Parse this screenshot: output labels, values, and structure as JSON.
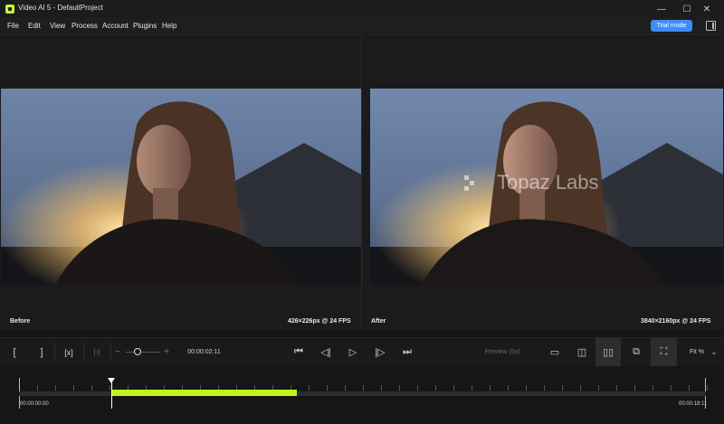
{
  "window": {
    "title": "Video AI 5 - DefaultProject"
  },
  "menu": [
    "File",
    "Edit",
    "View",
    "Process",
    "Account",
    "Plugins",
    "Help"
  ],
  "trial_label": "Trial mode",
  "before": {
    "label": "Before",
    "resolution": "426×226px @ 24 FPS"
  },
  "after": {
    "label": "After",
    "resolution": "3840×2160px @ 24 FPS",
    "watermark": "Topaz Labs"
  },
  "controls": {
    "current_time": "00:00:02:11",
    "preview_label": "Preview (5s)",
    "zoom_label": "Fit %",
    "zoom_value": 0.35
  },
  "timeline": {
    "start_time": "00:00:00:00",
    "end_time": "00:00:18:11",
    "selection_start": 0.135,
    "selection_end": 0.405
  }
}
